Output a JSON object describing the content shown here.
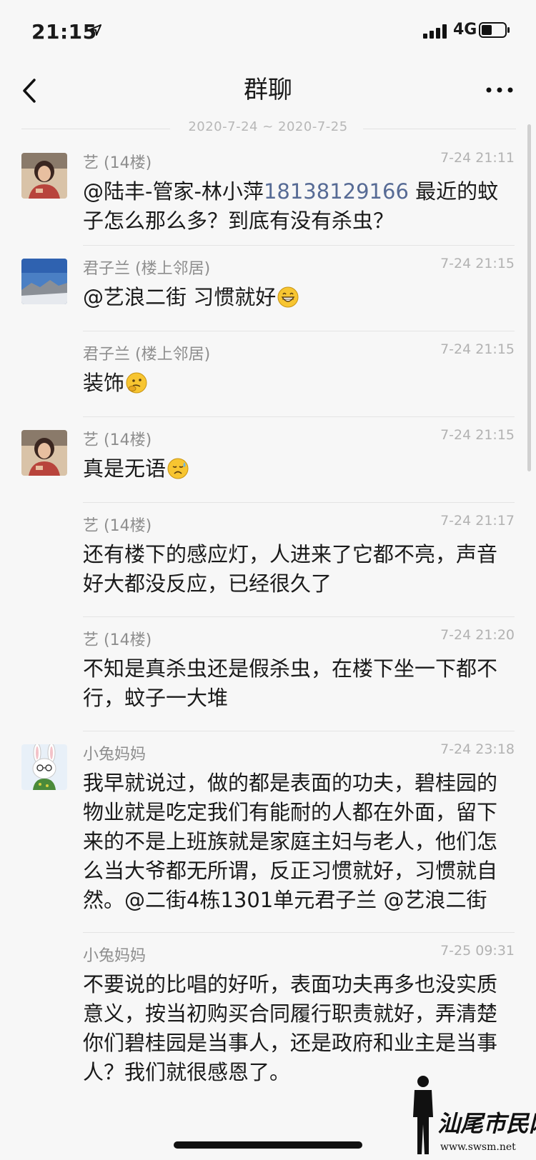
{
  "status_bar": {
    "time": "21:15",
    "network": "4G"
  },
  "nav": {
    "title": "群聊"
  },
  "date_range": "2020-7-24 ~ 2020-7-25",
  "messages": [
    {
      "sender": "艺 (14楼)",
      "time": "7-24 21:11",
      "avatar": "woman-photo",
      "show_avatar": true,
      "text_pre": "@陆丰-管家-林小萍",
      "phone": "18138129166",
      "text_post": " 最近的蚊子怎么那么多？到底有没有杀虫？"
    },
    {
      "sender": "君子兰 (楼上邻居)",
      "time": "7-24 21:15",
      "avatar": "landscape-photo",
      "show_avatar": true,
      "text": "@艺浪二街 习惯就好",
      "emoji": "grinning-face"
    },
    {
      "sender": "君子兰 (楼上邻居)",
      "time": "7-24 21:15",
      "show_avatar": false,
      "text": "装饰",
      "emoji": "thinking-face"
    },
    {
      "sender": "艺 (14楼)",
      "time": "7-24 21:15",
      "avatar": "woman-photo",
      "show_avatar": true,
      "text": "真是无语",
      "emoji": "sad-sweat-face"
    },
    {
      "sender": "艺 (14楼)",
      "time": "7-24 21:17",
      "show_avatar": false,
      "text": "还有楼下的感应灯，人进来了它都不亮，声音好大都没反应，已经很久了"
    },
    {
      "sender": "艺 (14楼)",
      "time": "7-24 21:20",
      "show_avatar": false,
      "text": "不知是真杀虫还是假杀虫，在楼下坐一下都不行，蚊子一大堆"
    },
    {
      "sender": "小兔妈妈",
      "time": "7-24 23:18",
      "avatar": "bunny-cartoon",
      "show_avatar": true,
      "text": "我早就说过，做的都是表面的功夫，碧桂园的物业就是吃定我们有能耐的人都在外面，留下来的不是上班族就是家庭主妇与老人，他们怎么当大爷都无所谓，反正习惯就好，习惯就自然。@二街4栋1301单元君子兰 @艺浪二街"
    },
    {
      "sender": "小兔妈妈",
      "time": "7-25 09:31",
      "show_avatar": false,
      "text": "不要说的比唱的好听，表面功夫再多也没实质意义，按当初购买合同履行职责就好，弄清楚你们碧桂园是当事人，还是政府和业主是当事人？我们就很感恩了。"
    }
  ],
  "watermark": {
    "text": "汕尾市民网",
    "url": "www.swsm.net"
  },
  "icons": [
    "location-arrow-icon",
    "signal-icon",
    "battery-icon",
    "back-icon",
    "more-icon"
  ]
}
